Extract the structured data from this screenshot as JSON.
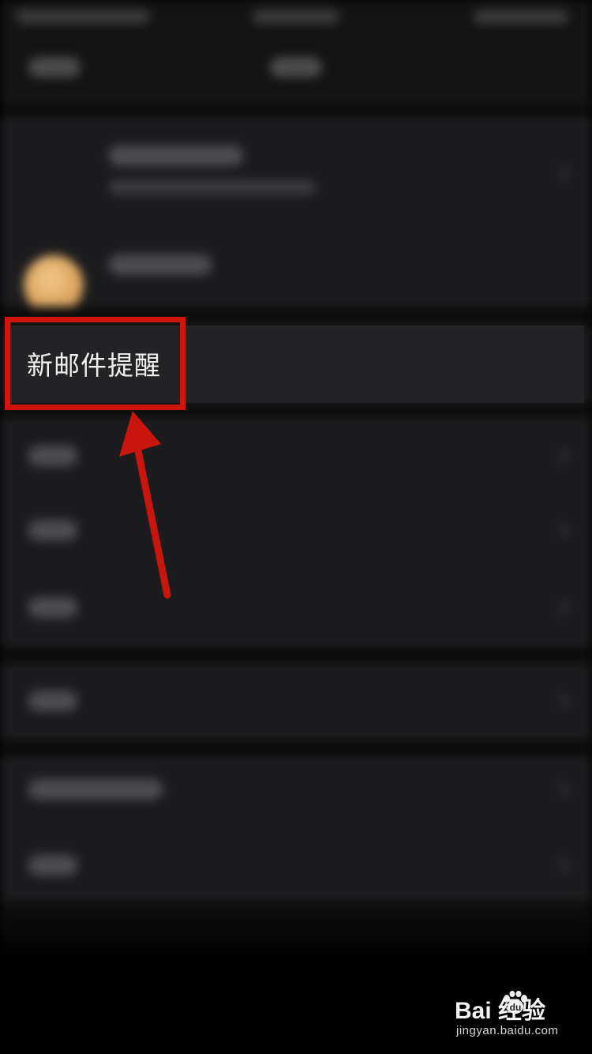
{
  "settings": {
    "highlighted_item": {
      "label": "新邮件提醒"
    }
  },
  "annotation": {
    "highlight_color": "#d0150c",
    "arrow_color": "#c8160e"
  },
  "watermark": {
    "brand": "Bai  经验",
    "url": "jingyan.baidu.com"
  }
}
